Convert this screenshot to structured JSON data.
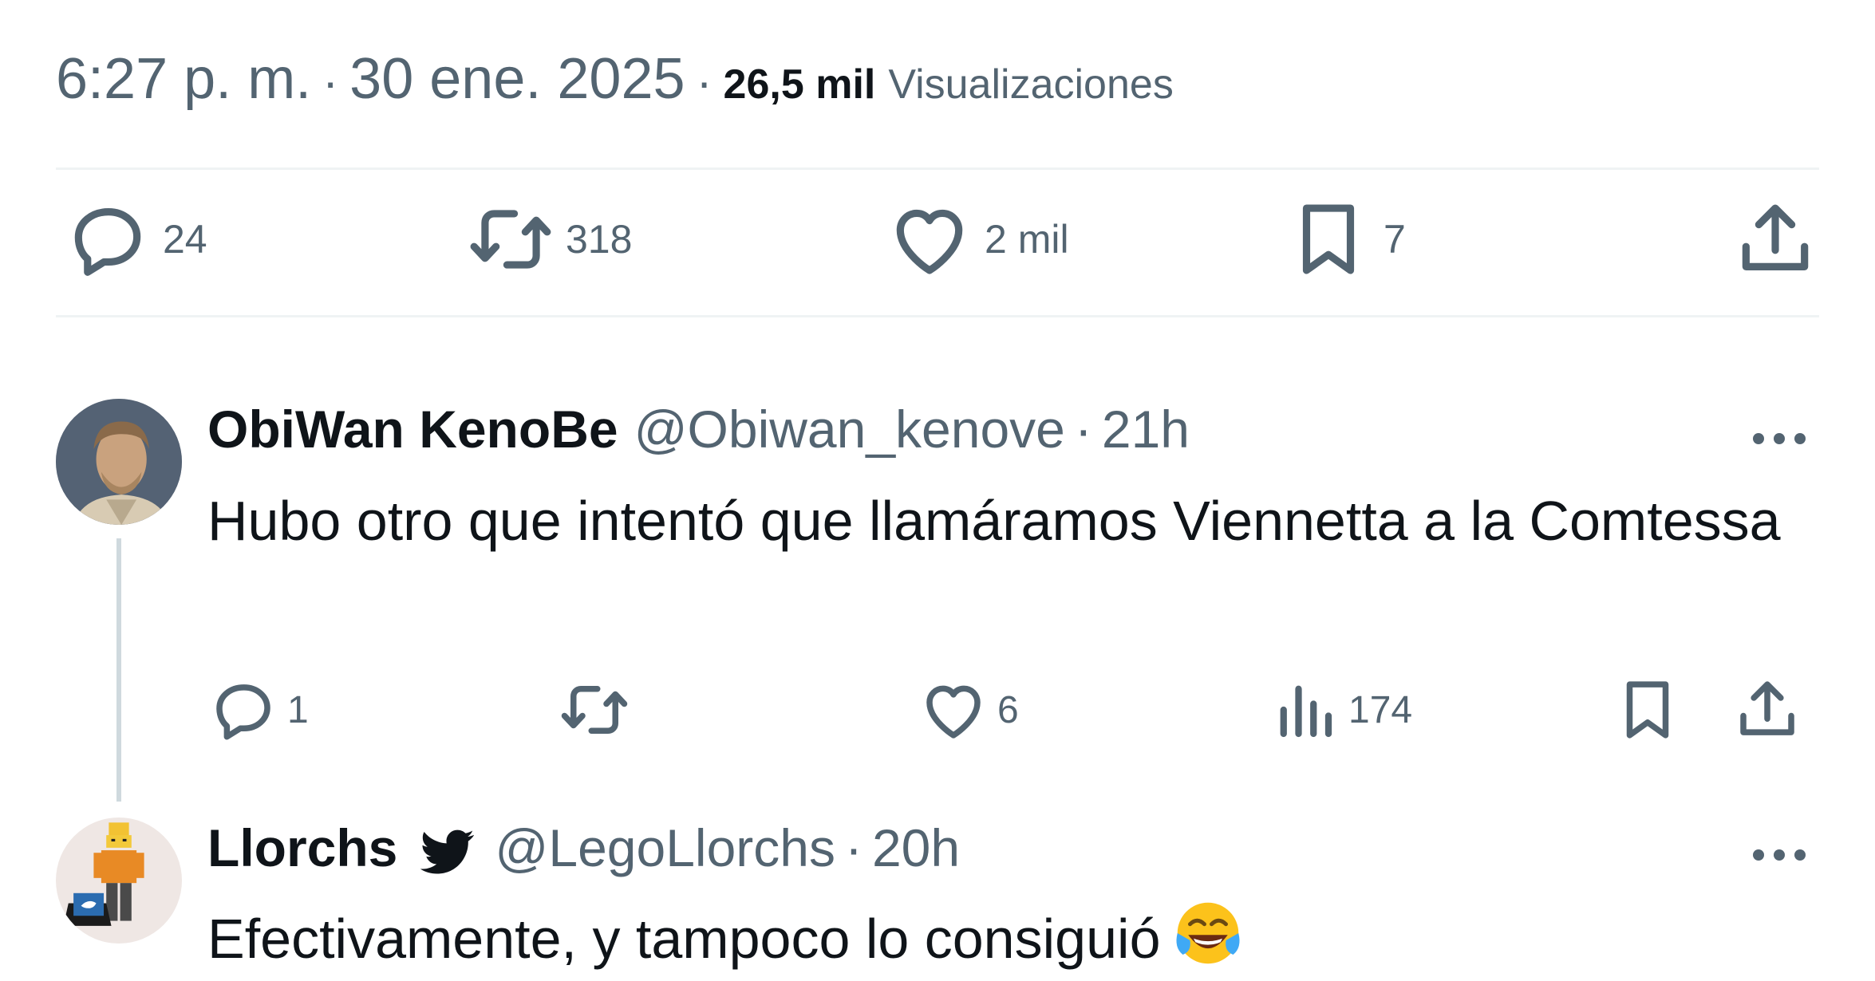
{
  "tweet_meta": {
    "time": "6:27 p. m.",
    "separator": "·",
    "date": "30 ene. 2025",
    "views_count": "26,5 mil",
    "views_label": "Visualizaciones"
  },
  "main_actions": {
    "replies": "24",
    "retweets": "318",
    "likes": "2 mil",
    "bookmarks": "7"
  },
  "replies": [
    {
      "name": "ObiWan KenoBe",
      "handle": "@Obiwan_kenove",
      "separator": "·",
      "time": "21h",
      "text": "Hubo otro que intentó que llamáramos Viennetta a la Comtessa",
      "actions": {
        "replies": "1",
        "retweets": "",
        "likes": "6",
        "views": "174"
      }
    },
    {
      "name": "Llorchs",
      "handle": "@LegoLlorchs",
      "separator": "·",
      "time": "20h",
      "text": "Efectivamente, y tampoco lo consiguió",
      "emoji": "face-with-tears-of-joy"
    }
  ],
  "colors": {
    "text_primary": "#0f1419",
    "text_secondary": "#536471",
    "divider": "#eff3f4",
    "thread_line": "#cfd9de"
  },
  "icons": [
    "reply-icon",
    "retweet-icon",
    "like-icon",
    "bookmark-icon",
    "share-icon",
    "views-icon",
    "more-icon",
    "twitter-bird-icon"
  ]
}
